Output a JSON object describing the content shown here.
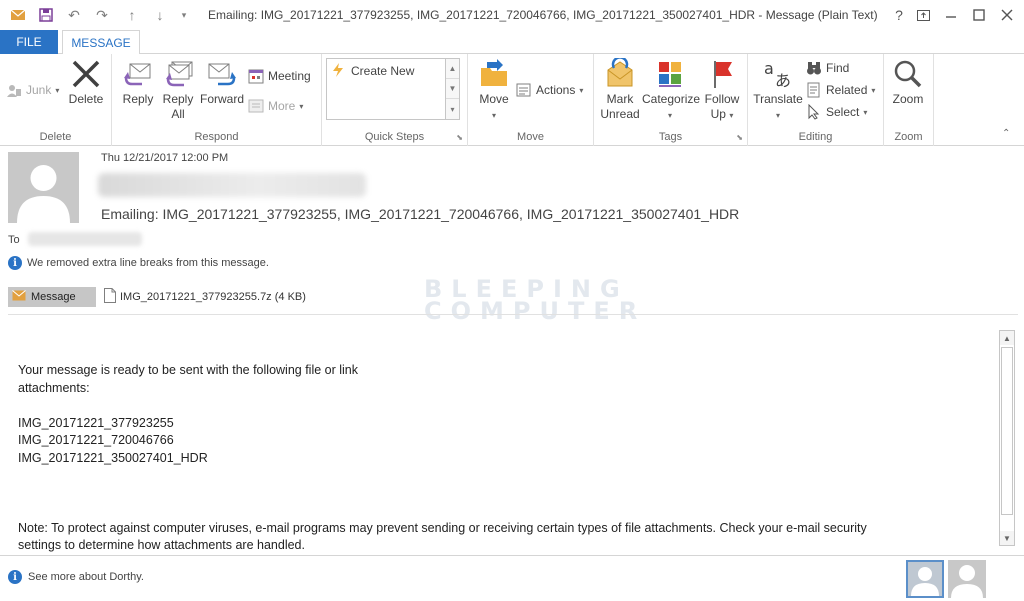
{
  "window": {
    "title": "Emailing: IMG_20171221_377923255, IMG_20171221_720046766, IMG_20171221_350027401_HDR - Message (Plain Text)",
    "help_label": "?",
    "colors": {
      "accent": "#2a73c5",
      "tab_file_bg": "#2a73c5",
      "reply_arrow": "#8b64b8",
      "forward_arrow": "#2a73c5",
      "flag": "#d9332b"
    }
  },
  "quick_access": {
    "icons": [
      "mail-icon",
      "save-icon",
      "undo-icon",
      "redo-icon",
      "up-arrow-icon",
      "down-arrow-icon",
      "customize-icon"
    ]
  },
  "tabs": {
    "file": "FILE",
    "message": "MESSAGE"
  },
  "ribbon": {
    "delete_group": {
      "label": "Delete",
      "junk": "Junk",
      "delete": "Delete"
    },
    "respond_group": {
      "label": "Respond",
      "reply": "Reply",
      "reply_all_line1": "Reply",
      "reply_all_line2": "All",
      "forward": "Forward",
      "meeting": "Meeting",
      "more": "More"
    },
    "quick_steps_group": {
      "label": "Quick Steps",
      "create_new": "Create New"
    },
    "move_group": {
      "label": "Move",
      "move": "Move",
      "actions": "Actions"
    },
    "tags_group": {
      "label": "Tags",
      "mark_unread_line1": "Mark",
      "mark_unread_line2": "Unread",
      "categorize": "Categorize",
      "follow_up_line1": "Follow",
      "follow_up_line2": "Up"
    },
    "editing_group": {
      "label": "Editing",
      "translate": "Translate",
      "find": "Find",
      "related": "Related",
      "select": "Select"
    },
    "zoom_group": {
      "label": "Zoom",
      "zoom": "Zoom"
    }
  },
  "message": {
    "date": "Thu 12/21/2017 12:00 PM",
    "subject": "Emailing: IMG_20171221_377923255, IMG_20171221_720046766, IMG_20171221_350027401_HDR",
    "to_label": "To",
    "info": "We removed extra line breaks from this message.",
    "message_tab": "Message",
    "attachment": "IMG_20171221_377923255.7z (4 KB)",
    "watermark_line1": "BLEEPING",
    "watermark_line2": "COMPUTER",
    "body": {
      "line1": "Your message is ready to be sent with the following file or link",
      "line2": "attachments:",
      "file1": "IMG_20171221_377923255",
      "file2": "IMG_20171221_720046766",
      "file3": "IMG_20171221_350027401_HDR",
      "note_line1": "Note: To protect against computer viruses, e-mail programs may prevent sending or receiving certain types of file attachments.  Check your e-mail security",
      "note_line2": "settings to determine how attachments are handled."
    }
  },
  "people_pane": {
    "see_more": "See more about Dorthy."
  }
}
